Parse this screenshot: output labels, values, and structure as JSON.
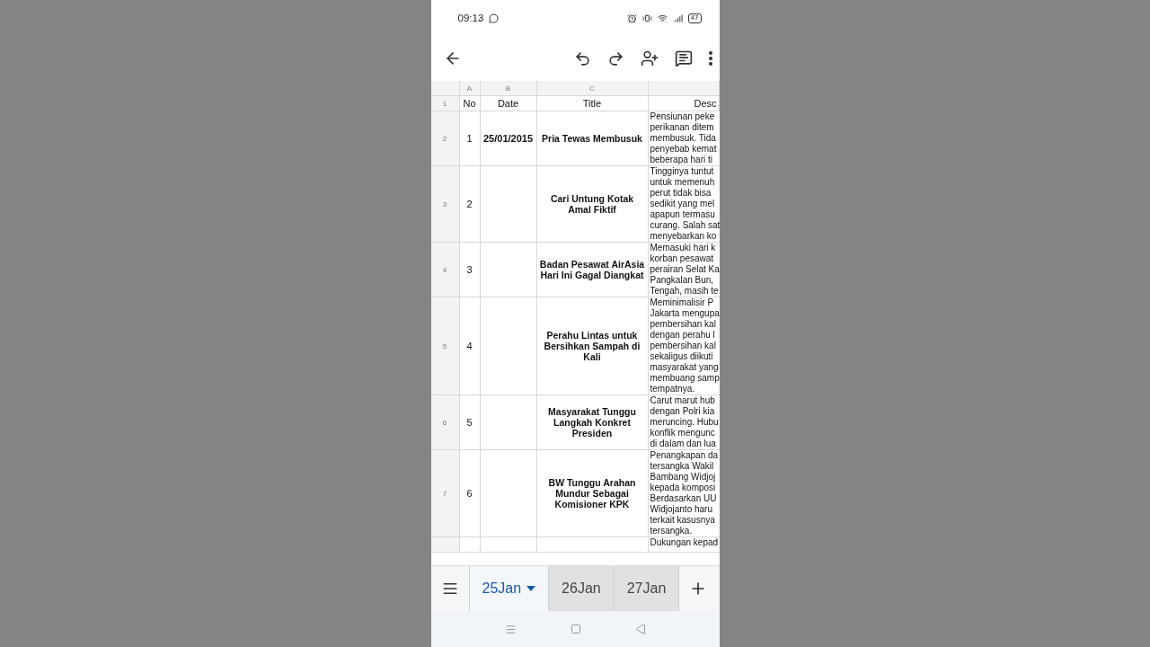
{
  "status_bar": {
    "time": "09:13",
    "battery": "47"
  },
  "sheet": {
    "column_letters": [
      "A",
      "B",
      "C"
    ],
    "header_row": {
      "row_number": "1",
      "cells": [
        "No",
        "Date",
        "Title",
        "Desc"
      ]
    },
    "rows": [
      {
        "row_number": "2",
        "no": "1",
        "date": "25/01/2015",
        "title": "Pria Tewas Membusuk",
        "description": [
          "Pensiunan peke",
          "perikanan ditem",
          "membusuk. Tida",
          "penyebab kemat",
          "beberapa hari ti"
        ]
      },
      {
        "row_number": "3",
        "no": "2",
        "title": "Cari Untung Kotak Amal Fiktif",
        "description": [
          "Tingginya tuntut",
          "untuk memenuh",
          "perut tidak bisa",
          "sedikit yang mel",
          "apapun termasu",
          "curang. Salah sat",
          "menyebarkan ko"
        ]
      },
      {
        "row_number": "4",
        "no": "3",
        "title": "Badan Pesawat AirAsia Hari Ini Gagal Diangkat",
        "description": [
          "Memasuki hari k",
          "korban pesawat",
          "perairan Selat Ka",
          "Pangkalan Bun,",
          "Tengah, masih te"
        ]
      },
      {
        "row_number": "5",
        "no": "4",
        "title": "Perahu Lintas untuk Bersihkan Sampah di Kali",
        "description": [
          "Meminimalisir P",
          "Jakarta mengupa",
          "pembersihan kal",
          "dengan perahu l",
          "pembersihan kal",
          "sekaligus diikuti",
          "masyarakat yang",
          "membuang samp",
          "tempatnya."
        ]
      },
      {
        "row_number": "6",
        "no": "5",
        "title": "Masyarakat Tunggu Langkah Konkret Presiden",
        "description": [
          "Carut marut hub",
          "dengan Polri kia",
          "meruncing. Hubu",
          "konflik mengunc",
          "di dalam dan lua"
        ]
      },
      {
        "row_number": "7",
        "no": "6",
        "title": "BW Tunggu Arahan Mundur Sebagai Komisioner KPK",
        "description": [
          "Penangkapan da",
          "tersangka Wakil",
          "Bambang Widjoj",
          "kepada komposi",
          "Berdasarkan UU",
          "Widjojanto haru",
          "terkait kasusnya",
          "tersangka."
        ]
      },
      {
        "description": [
          "Dukungan kepad"
        ]
      }
    ]
  },
  "sheet_tabs": [
    {
      "label": "25Jan",
      "selected": true
    },
    {
      "label": "26Jan",
      "selected": false
    },
    {
      "label": "27Jan",
      "selected": false
    }
  ]
}
